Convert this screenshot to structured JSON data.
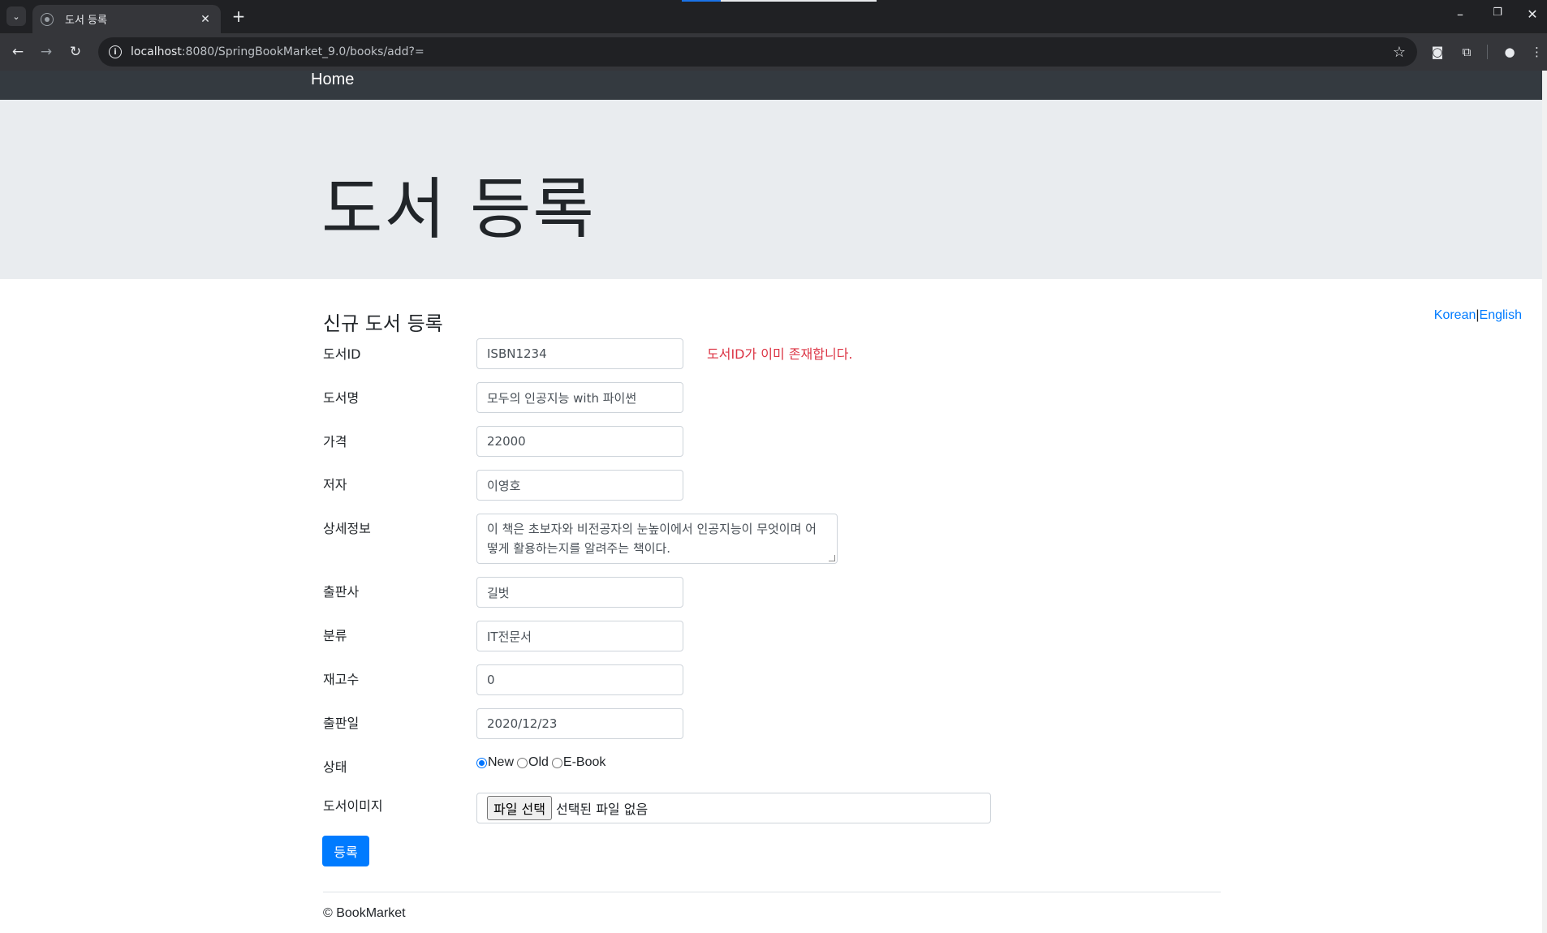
{
  "browser": {
    "tab_title": "도서 등록",
    "tab_close": "✕",
    "new_tab": "+",
    "url_host": "localhost",
    "url_rest": ":8080/SpringBookMarket_9.0/books/add?=",
    "icons": [
      "tab-list-icon",
      "globe-icon",
      "back-icon",
      "forward-icon",
      "reload-icon",
      "info-icon",
      "star-icon",
      "camera-icon",
      "extensions-icon",
      "profile-icon",
      "menu-icon",
      "minimize-icon",
      "restore-icon",
      "close-icon"
    ]
  },
  "navbar": {
    "brand": "Home"
  },
  "jumbotron": {
    "title": "도서 등록"
  },
  "lang": {
    "korean": "Korean",
    "separator": "|",
    "english": "English"
  },
  "form": {
    "title": "신규 도서 등록",
    "error": "도서ID가 이미 존재합니다.",
    "fields": {
      "book_id": {
        "label": "도서ID",
        "value": "ISBN1234"
      },
      "name": {
        "label": "도서명",
        "value": "모두의 인공지능 with 파이썬"
      },
      "price": {
        "label": "가격",
        "value": "22000"
      },
      "author": {
        "label": "저자",
        "value": "이영호"
      },
      "description": {
        "label": "상세정보",
        "value": "이 책은 초보자와 비전공자의 눈높이에서 인공지능이 무엇이며 어떻게 활용하는지를 알려주는 책이다."
      },
      "publisher": {
        "label": "출판사",
        "value": "길벗"
      },
      "category": {
        "label": "분류",
        "value": "IT전문서"
      },
      "stock": {
        "label": "재고수",
        "value": "0"
      },
      "release_date": {
        "label": "출판일",
        "value": "2020/12/23"
      },
      "condition": {
        "label": "상태",
        "options": [
          "New",
          "Old",
          "E-Book"
        ],
        "selected": "New"
      },
      "image": {
        "label": "도서이미지",
        "button": "파일 선택",
        "status": "선택된 파일 없음"
      }
    },
    "submit": "등록"
  },
  "footer": {
    "text": "© BookMarket"
  },
  "colors": {
    "navbar": "#343a40",
    "jumbotron": "#e9ecef",
    "primary": "#007bff",
    "danger": "#dc3545"
  }
}
